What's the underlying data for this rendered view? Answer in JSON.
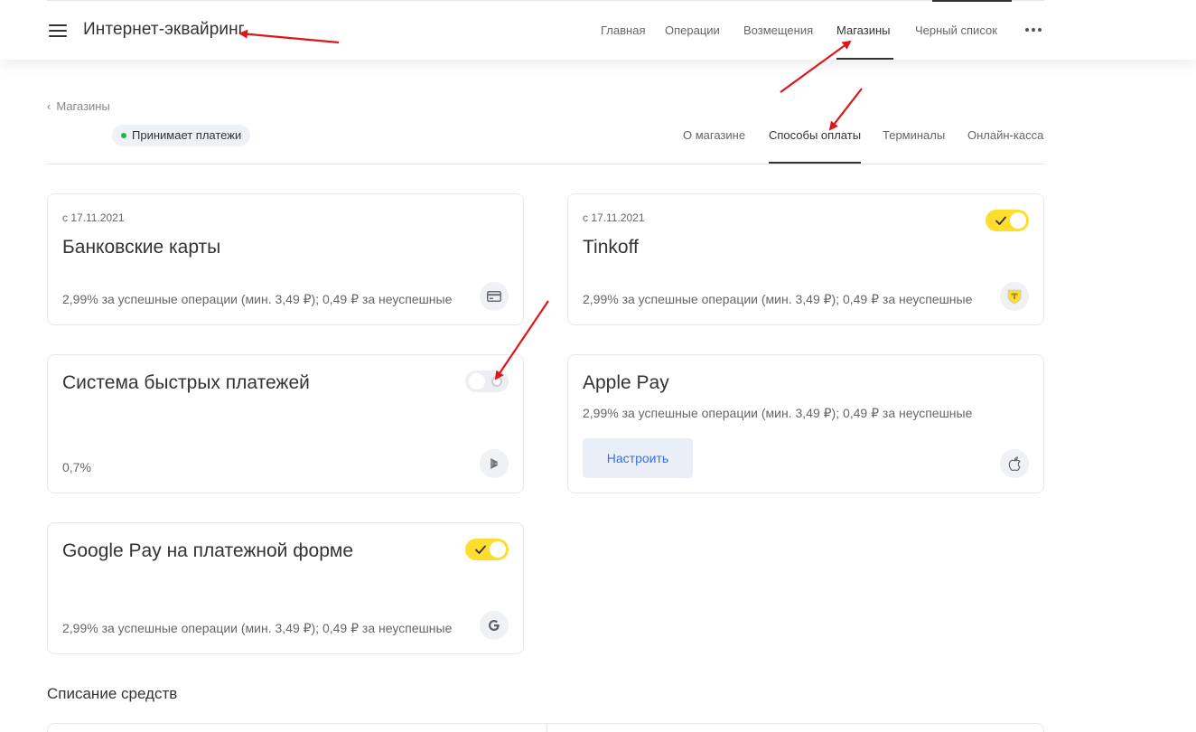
{
  "header": {
    "title": "Интернет-эквайринг",
    "nav": [
      {
        "label": "Главная",
        "active": false
      },
      {
        "label": "Операции",
        "active": false
      },
      {
        "label": "Возмещения",
        "active": false
      },
      {
        "label": "Магазины",
        "active": true
      },
      {
        "label": "Черный список",
        "active": false
      }
    ],
    "menu_icon": "hamburger-menu-icon",
    "more_icon": "more-dots-icon"
  },
  "store": {
    "back_label": "Магазины",
    "status": "Принимает платежи",
    "status_color": "#20b548",
    "tabs": [
      {
        "label": "О магазине",
        "active": false
      },
      {
        "label": "Способы оплаты",
        "active": true
      },
      {
        "label": "Терминалы",
        "active": false
      },
      {
        "label": "Онлайн-касса",
        "active": false
      }
    ]
  },
  "payment_methods": [
    {
      "date": "с 17.11.2021",
      "title": "Банковские карты",
      "fee": "2,99% за успешные операции (мин. 3,49 ₽); 0,49 ₽ за неуспешные",
      "icon": "bank-card-icon",
      "has_toggle": false
    },
    {
      "date": "с 17.11.2021",
      "title": "Tinkoff",
      "fee": "2,99% за успешные операции (мин. 3,49 ₽); 0,49 ₽ за неуспешные",
      "icon": "tinkoff-logo-icon",
      "has_toggle": true,
      "enabled": true
    },
    {
      "title": "Система быстрых платежей",
      "fee": "0,7%",
      "icon": "sbp-icon",
      "has_toggle": true,
      "enabled": false
    },
    {
      "title": "Apple Pay",
      "fee": "2,99% за успешные операции (мин. 3,49 ₽); 0,49 ₽ за неуспешные",
      "icon": "apple-icon",
      "button_label": "Настроить",
      "has_toggle": false
    },
    {
      "title": "Google Pay на платежной форме",
      "fee": "2,99% за успешные операции (мин. 3,49 ₽); 0,49 ₽ за неуспешные",
      "icon": "google-icon",
      "has_toggle": true,
      "enabled": true
    }
  ],
  "section": {
    "title": "Списание средств"
  },
  "colors": {
    "toggle_on": "#ffdd2d",
    "toggle_off": "#eceef2",
    "link_blue": "#336fee",
    "annotation_red": "#e0151b"
  }
}
